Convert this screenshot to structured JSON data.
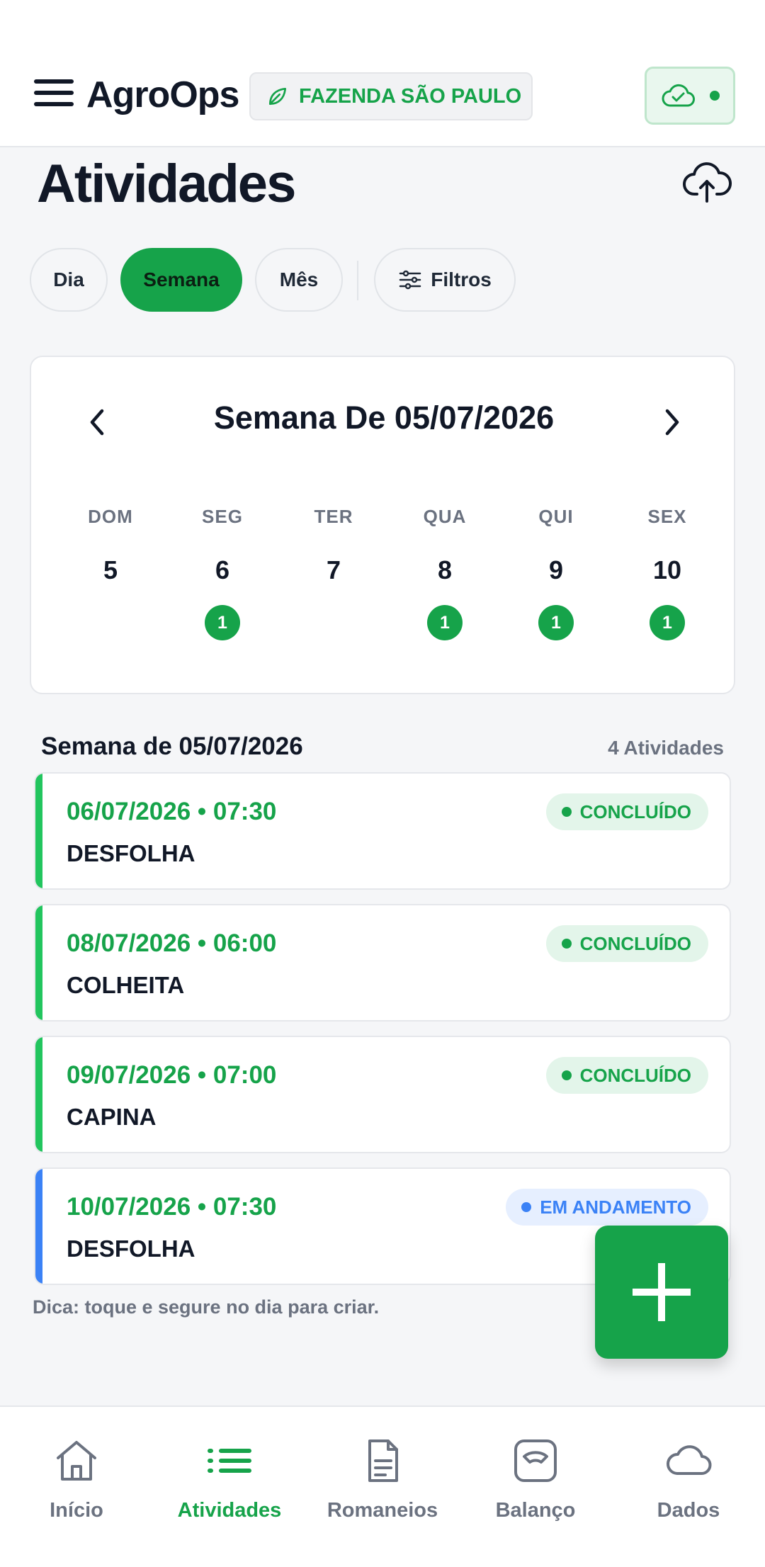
{
  "appbar": {
    "brand": "AgroOps",
    "farm": "FAZENDA SÃO PAULO",
    "menu_icon": "menu-icon",
    "sync_icon": "cloud-check-icon",
    "sync_status_color": "#16a34a"
  },
  "page": {
    "title": "Atividades",
    "upload_icon": "cloud-upload-icon"
  },
  "view_tabs": {
    "items": [
      {
        "label": "Dia",
        "active": false
      },
      {
        "label": "Semana",
        "active": true
      },
      {
        "label": "Mês",
        "active": false
      }
    ],
    "filters_label": "Filtros"
  },
  "calendar": {
    "title": "Semana De 05/07/2026",
    "days": [
      {
        "dow": "DOM",
        "day": "5",
        "count": null
      },
      {
        "dow": "SEG",
        "day": "6",
        "count": "1"
      },
      {
        "dow": "TER",
        "day": "7",
        "count": null
      },
      {
        "dow": "QUA",
        "day": "8",
        "count": "1"
      },
      {
        "dow": "QUI",
        "day": "9",
        "count": "1"
      },
      {
        "dow": "SEX",
        "day": "10",
        "count": "1"
      }
    ]
  },
  "list": {
    "title": "Semana de 05/07/2026",
    "count_label": "4 Atividades",
    "items": [
      {
        "when": "06/07/2026 • 07:30",
        "name": "DESFOLHA",
        "status": "CONCLUÍDO",
        "status_type": "done"
      },
      {
        "when": "08/07/2026 • 06:00",
        "name": "COLHEITA",
        "status": "CONCLUÍDO",
        "status_type": "done"
      },
      {
        "when": "09/07/2026 • 07:00",
        "name": "CAPINA",
        "status": "CONCLUÍDO",
        "status_type": "done"
      },
      {
        "when": "10/07/2026 • 07:30",
        "name": "DESFOLHA",
        "status": "EM ANDAMENTO",
        "status_type": "progress"
      }
    ],
    "hint": "Dica: toque e segure no dia para criar."
  },
  "colors": {
    "accent": "#16a34a",
    "done_bg": "#e3f5ea",
    "progress": "#3b82f6",
    "progress_bg": "#e6efff"
  },
  "bottom_nav": {
    "items": [
      {
        "label": "Início",
        "icon": "home-icon",
        "active": false
      },
      {
        "label": "Atividades",
        "icon": "list-icon",
        "active": true
      },
      {
        "label": "Romaneios",
        "icon": "document-icon",
        "active": false
      },
      {
        "label": "Balanço",
        "icon": "scale-icon",
        "active": false
      },
      {
        "label": "Dados",
        "icon": "cloud-icon",
        "active": false
      }
    ]
  }
}
